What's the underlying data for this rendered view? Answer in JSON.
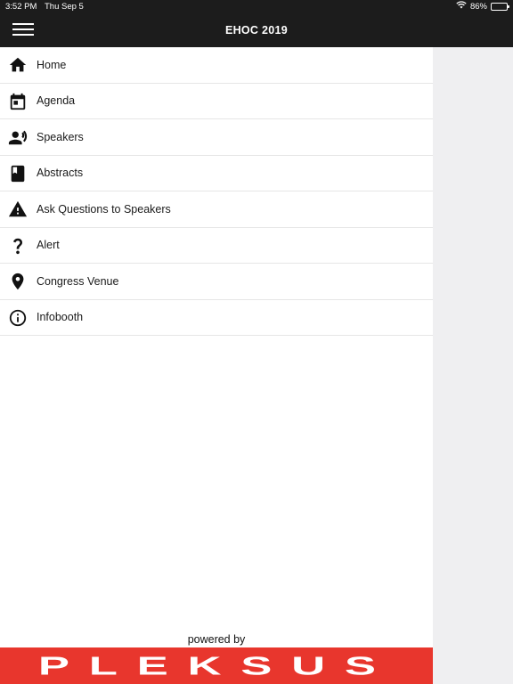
{
  "status_bar": {
    "time": "3:52 PM",
    "date": "Thu Sep 5",
    "battery_percent": "86%",
    "battery_level": 0.86
  },
  "header": {
    "title": "EHOC 2019"
  },
  "menu": {
    "items": [
      {
        "label": "Home",
        "icon": "home-icon"
      },
      {
        "label": "Agenda",
        "icon": "calendar-icon"
      },
      {
        "label": "Speakers",
        "icon": "speaker-icon"
      },
      {
        "label": "Abstracts",
        "icon": "book-icon"
      },
      {
        "label": "Ask Questions to Speakers",
        "icon": "warning-icon"
      },
      {
        "label": "Alert",
        "icon": "question-icon"
      },
      {
        "label": "Congress Venue",
        "icon": "location-pin-icon"
      },
      {
        "label": "Infobooth",
        "icon": "info-icon"
      }
    ]
  },
  "footer": {
    "powered_by": "powered by",
    "brand": "PLEKSUS"
  },
  "colors": {
    "bar_background": "#1c1c1c",
    "brand_red": "#e8362d",
    "battery_green": "#3ccf4e"
  }
}
